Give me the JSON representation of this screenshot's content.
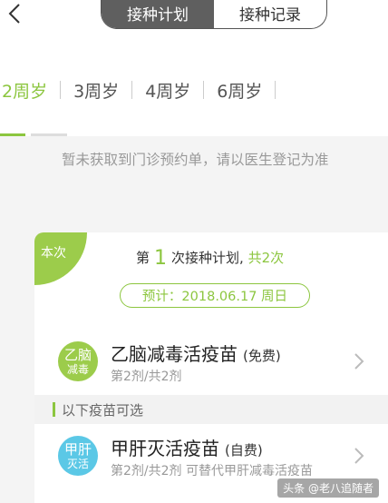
{
  "header": {
    "tabs": [
      {
        "label": "接种计划",
        "active": true
      },
      {
        "label": "接种记录",
        "active": false
      }
    ]
  },
  "age_tabs": [
    "2周岁",
    "3周岁",
    "4周岁",
    "6周岁"
  ],
  "notice": "暂未获取到门诊预约单，请以医生登记为准",
  "plan": {
    "corner_label": "本次",
    "prefix": "第",
    "number": "1",
    "suffix": "次接种计划,",
    "total": "共2次",
    "date": "预计：2018.06.17 周日"
  },
  "vaccines": [
    {
      "icon_line1": "乙脑",
      "icon_line2": "减毒",
      "name": "乙脑减毒活疫苗",
      "tag": "(免费)",
      "sub": "第2剂/共2剂",
      "icon_color": "#9ccc4b"
    },
    {
      "icon_line1": "甲肝",
      "icon_line2": "灭活",
      "name": "甲肝灭活疫苗",
      "tag": "(自费)",
      "sub": "第2剂/共2剂  可替代甲肝减毒活疫苗",
      "icon_color": "#5bc8e6"
    }
  ],
  "optional_label": "以下疫苗可选",
  "watermark": "头条 @老八追随者",
  "colors": {
    "accent": "#8cc63f",
    "blue": "#5bc8e6"
  }
}
